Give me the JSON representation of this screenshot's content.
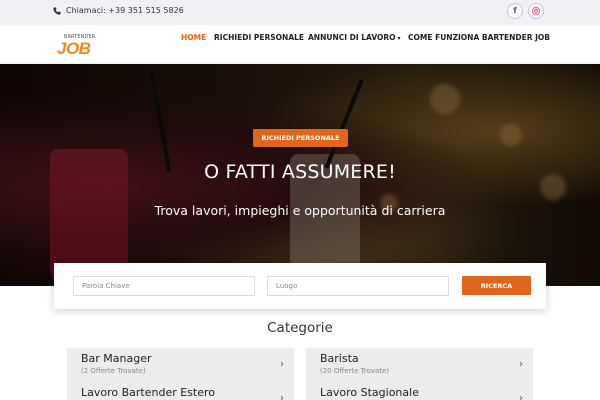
{
  "topbar": {
    "phone": "Chiamaci: +39 351 515 5826",
    "social": [
      {
        "icon": "facebook-icon",
        "glyph": "f"
      },
      {
        "icon": "instagram-icon"
      }
    ]
  },
  "navbar": {
    "logo_small": "BARTENDER",
    "logo_big": "JOB",
    "items": [
      {
        "label": "HOME",
        "active": true
      },
      {
        "label": "RICHIEDI PERSONALE",
        "active": false
      },
      {
        "label": "ANNUNCI DI LAVORO",
        "active": false,
        "dropdown": true
      },
      {
        "label": "COME FUNZIONA BARTENDER JOB",
        "active": false
      }
    ]
  },
  "hero": {
    "button": "RICHIEDI PERSONALE",
    "title": "O FATTI ASSUMERE!",
    "subtitle": "Trova lavori, impieghi e opportunità di carriera"
  },
  "search": {
    "keyword_placeholder": "Parola Chiave",
    "location_placeholder": "Luogo",
    "button": "RICERCA"
  },
  "categories": {
    "title": "Categorie",
    "items": [
      {
        "name": "Bar Manager",
        "count": "(2 Offerte Trovate)"
      },
      {
        "name": "Barista",
        "count": "(20 Offerte Trovate)"
      },
      {
        "name": "Lavoro Bartender Estero",
        "count": ""
      },
      {
        "name": "Lavoro Stagionale",
        "count": ""
      }
    ]
  },
  "colors": {
    "accent": "#e0661d",
    "logo": "#f08a1d",
    "topbar_bg": "#f1f0f5"
  }
}
